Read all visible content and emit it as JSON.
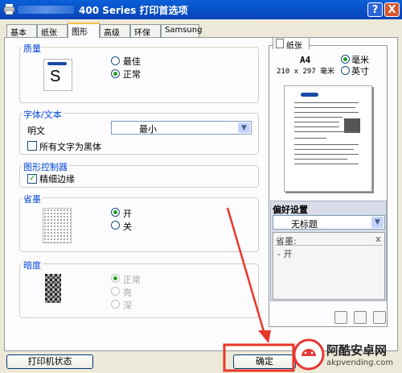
{
  "window": {
    "title": "400 Series 打印首选项",
    "help_label": "?",
    "close_label": "X"
  },
  "tabs": [
    "基本",
    "纸张",
    "图形",
    "高级",
    "环保",
    "Samsung"
  ],
  "quality": {
    "title": "质量",
    "preview_letter": "S",
    "options": [
      "最佳",
      "正常"
    ],
    "selected": "正常"
  },
  "font_text": {
    "title": "字体/文本",
    "label": "明文",
    "select_value": "最小",
    "checkbox_label": "所有文字为黑体",
    "checkbox_checked": false
  },
  "graphic_controller": {
    "title": "图形控制器",
    "checkbox_label": "精细边缘",
    "checkbox_checked": true
  },
  "toner_save": {
    "title": "省墨",
    "options": [
      "开",
      "关"
    ],
    "selected": "开"
  },
  "darkness": {
    "title": "暗度",
    "options": [
      "正常",
      "亮",
      "深"
    ],
    "selected": "正常",
    "enabled": false
  },
  "paper_panel": {
    "tab_label": "纸张",
    "paper_size": "A4",
    "paper_dims": "210 x 297 毫米",
    "units": [
      "毫米",
      "英寸"
    ],
    "unit_selected": "毫米"
  },
  "preferences": {
    "title": "偏好设置",
    "select_value": "无标题",
    "list_header": "省墨:",
    "list_close": "x",
    "list_items": [
      "- 开"
    ]
  },
  "buttons": {
    "printer_status": "打印机状态",
    "ok": "确定"
  },
  "colors": {
    "title_bar": "#0a5fd7",
    "group_title": "#0046d5",
    "annotation_red": "#e8382a"
  },
  "watermark": {
    "text": "阿酷安卓网",
    "url": "akpvending.com"
  }
}
